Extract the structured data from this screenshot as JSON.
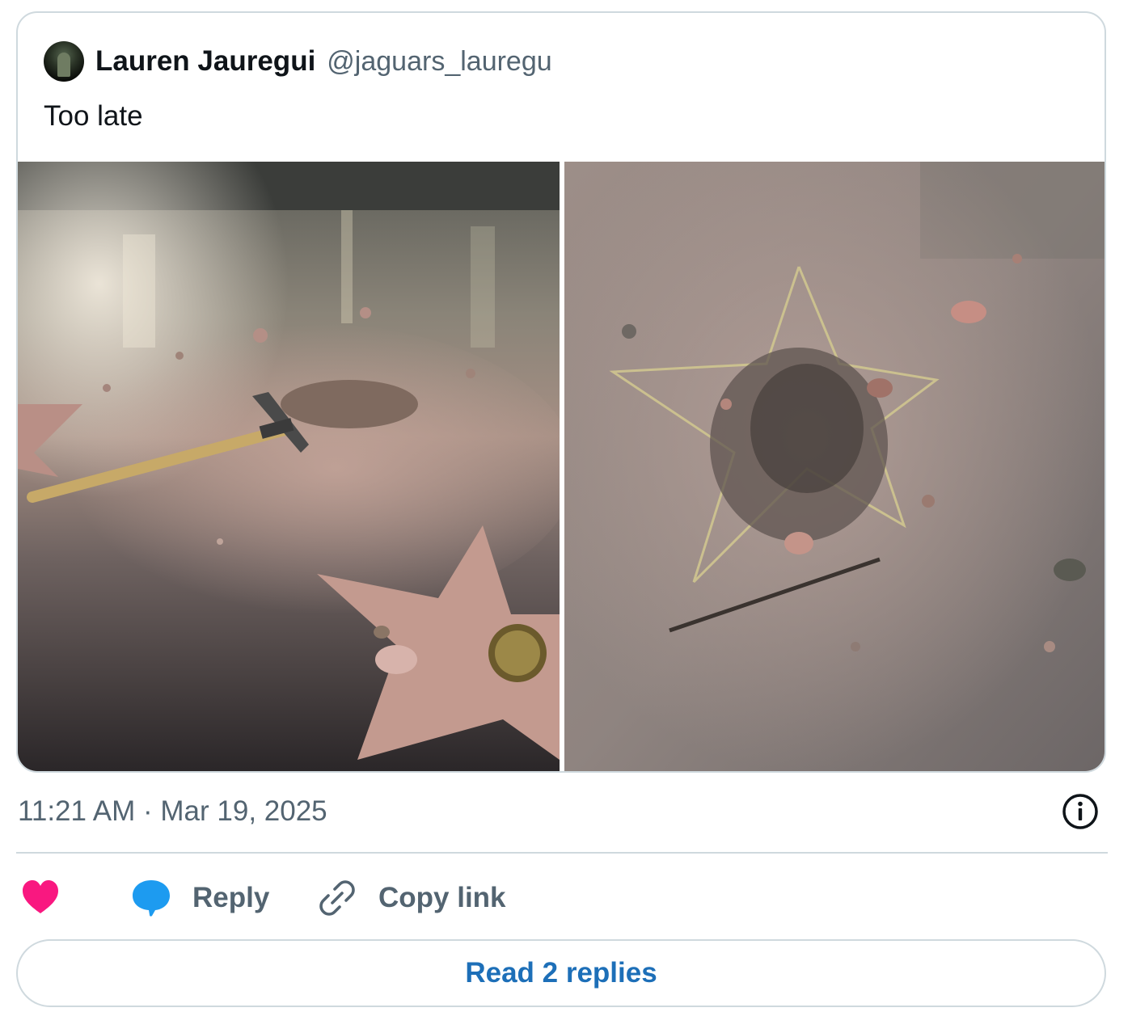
{
  "tweet": {
    "author_name": "Lauren Jauregui",
    "author_handle": "@jaguars_lauregu",
    "text": "Too late",
    "timestamp": "11:21 AM · Mar 19, 2025",
    "media": [
      {
        "icon": "photo-pickaxe-on-star-icon"
      },
      {
        "icon": "photo-damaged-star-icon"
      }
    ]
  },
  "actions": {
    "like_icon": "heart-icon",
    "reply_label": "Reply",
    "copy_link_label": "Copy link"
  },
  "footer": {
    "read_replies_label": "Read 2 replies"
  },
  "colors": {
    "like": "#f91880",
    "reply": "#1d9bf0",
    "link_text": "#1d6fb8",
    "secondary_text": "#536471",
    "border": "#cfd9de"
  }
}
